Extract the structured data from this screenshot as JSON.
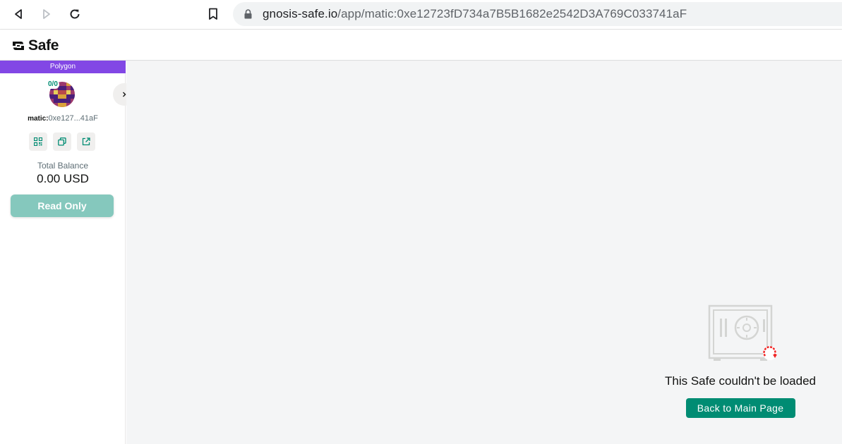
{
  "browser": {
    "url_host": "gnosis-safe.io",
    "url_path": "/app/matic:0xe12723fD734a7B5B1682e2542D3A769C033741aF",
    "icons": [
      "back-icon",
      "forward-icon",
      "reload-icon",
      "bookmark-icon",
      "lock-icon"
    ]
  },
  "header": {
    "logo_text": "Safe"
  },
  "sidebar": {
    "network": "Polygon",
    "network_color": "#8247e5",
    "threshold": "0/0",
    "address_prefix": "matic:",
    "address_short": "0xe127...41aF",
    "action_icons": [
      "qr-code-icon",
      "copy-icon",
      "external-link-icon"
    ],
    "balance_label": "Total Balance",
    "balance_value": "0.00 USD",
    "read_only_label": "Read Only"
  },
  "main": {
    "error_message": "This Safe couldn't be loaded",
    "back_button_label": "Back to Main Page",
    "accent_color": "#008c73"
  }
}
